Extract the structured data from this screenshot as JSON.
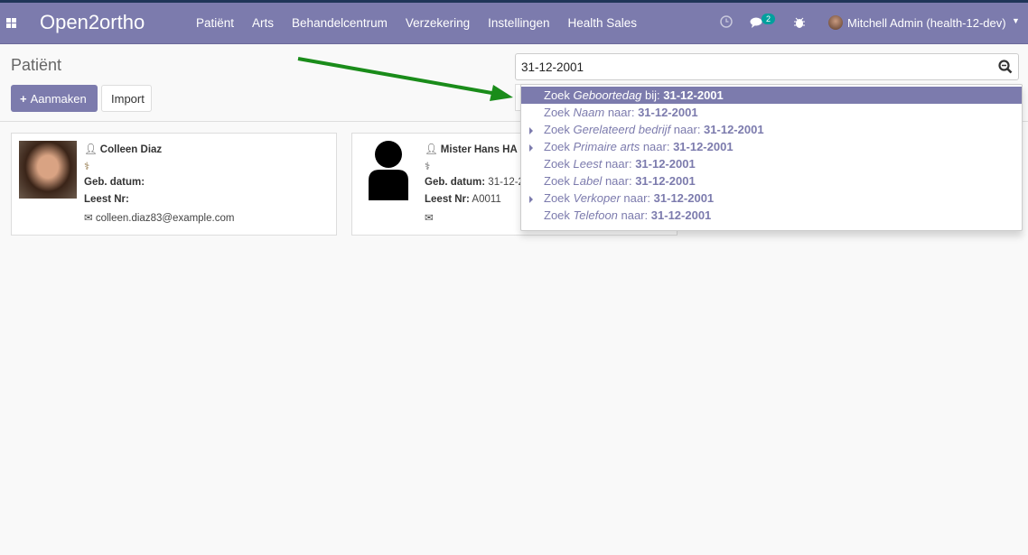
{
  "navbar": {
    "brand": "Open2ortho",
    "menu": [
      "Patiënt",
      "Arts",
      "Behandelcentrum",
      "Verzekering",
      "Instellingen",
      "Health Sales"
    ],
    "messages_count": "2",
    "user": "Mitchell Admin (health-12-dev)"
  },
  "page": {
    "title": "Patiënt",
    "create_label": "Aanmaken",
    "import_label": "Import"
  },
  "search": {
    "value": "31-12-2001",
    "suggestions": [
      {
        "prefix": "Zoek ",
        "field": "Geboortedag",
        "mid": " bij: ",
        "value": "31-12-2001",
        "expandable": false,
        "selected": true
      },
      {
        "prefix": "Zoek ",
        "field": "Naam",
        "mid": " naar: ",
        "value": "31-12-2001",
        "expandable": false
      },
      {
        "prefix": "Zoek ",
        "field": "Gerelateerd bedrijf",
        "mid": " naar: ",
        "value": "31-12-2001",
        "expandable": true
      },
      {
        "prefix": "Zoek ",
        "field": "Primaire arts",
        "mid": " naar: ",
        "value": "31-12-2001",
        "expandable": true
      },
      {
        "prefix": "Zoek ",
        "field": "Leest",
        "mid": " naar: ",
        "value": "31-12-2001",
        "expandable": false
      },
      {
        "prefix": "Zoek ",
        "field": "Label",
        "mid": " naar: ",
        "value": "31-12-2001",
        "expandable": false
      },
      {
        "prefix": "Zoek ",
        "field": "Verkoper",
        "mid": " naar: ",
        "value": "31-12-2001",
        "expandable": true
      },
      {
        "prefix": "Zoek ",
        "field": "Telefoon",
        "mid": " naar: ",
        "value": "31-12-2001",
        "expandable": false
      }
    ]
  },
  "cards": [
    {
      "name": "Colleen Diaz",
      "dob_label": "Geb. datum:",
      "dob": "",
      "leest_label": "Leest Nr:",
      "leest": "",
      "email": "colleen.diaz83@example.com"
    },
    {
      "name": "Mister Hans HA",
      "dob_label": "Geb. datum:",
      "dob": "31-12-2",
      "leest_label": "Leest Nr:",
      "leest": "A0011",
      "email": ""
    }
  ],
  "colors": {
    "brand": "#7c7bad",
    "badge": "#00a09d",
    "arrow": "#1a8c1a"
  }
}
